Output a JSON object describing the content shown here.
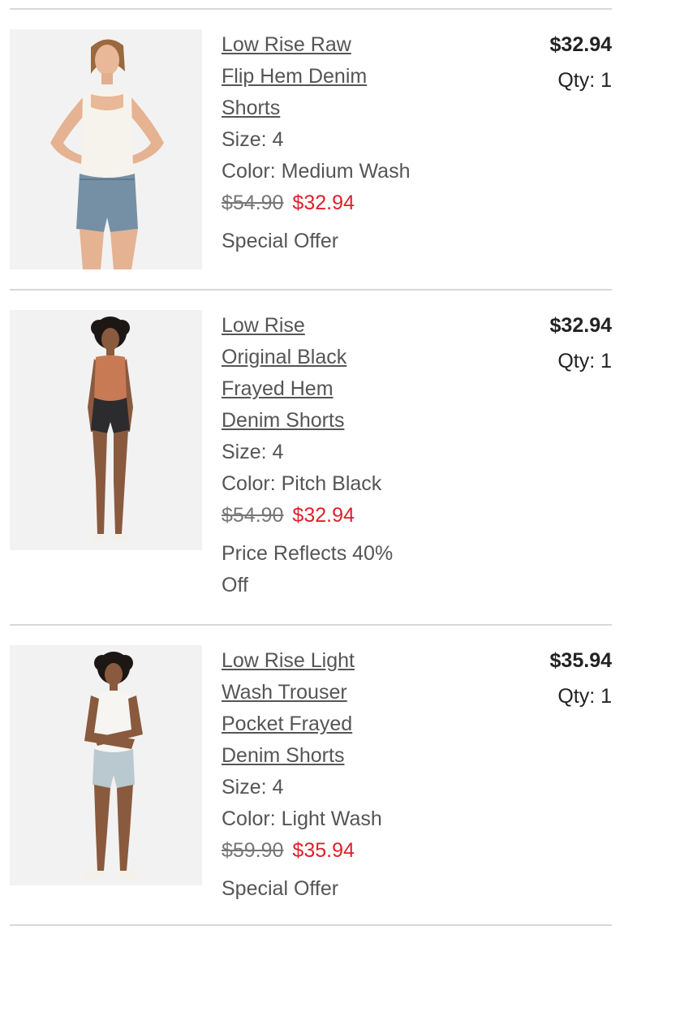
{
  "items": [
    {
      "name_lines": [
        "Low Rise Raw",
        "Flip Hem Denim",
        "Shorts"
      ],
      "size": "Size: 4",
      "color": "Color: Medium Wash",
      "original_price": "$54.90",
      "sale_price": "$32.94",
      "offer_lines": [
        "Special Offer"
      ],
      "total": "$32.94",
      "qty": "Qty: 1",
      "image_icon": "model-white-tank-blue-shorts"
    },
    {
      "name_lines": [
        "Low Rise",
        "Original Black",
        "Frayed Hem",
        "Denim Shorts"
      ],
      "size": "Size: 4",
      "color": "Color: Pitch Black",
      "original_price": "$54.90",
      "sale_price": "$32.94",
      "offer_lines": [
        "Price Reflects 40%",
        "Off"
      ],
      "total": "$32.94",
      "qty": "Qty: 1",
      "image_icon": "model-orange-tank-black-shorts"
    },
    {
      "name_lines": [
        "Low Rise Light",
        "Wash Trouser",
        "Pocket Frayed",
        "Denim Shorts"
      ],
      "size": "Size: 4",
      "color": "Color: Light Wash",
      "original_price": "$59.90",
      "sale_price": "$35.94",
      "offer_lines": [
        "Special Offer"
      ],
      "total": "$35.94",
      "qty": "Qty: 1",
      "image_icon": "model-white-tank-light-shorts"
    }
  ],
  "colors": {
    "sale_price": "#e0202a",
    "text": "#555555",
    "divider": "#d8d8d8",
    "thumb_bg": "#f2f2f2"
  }
}
